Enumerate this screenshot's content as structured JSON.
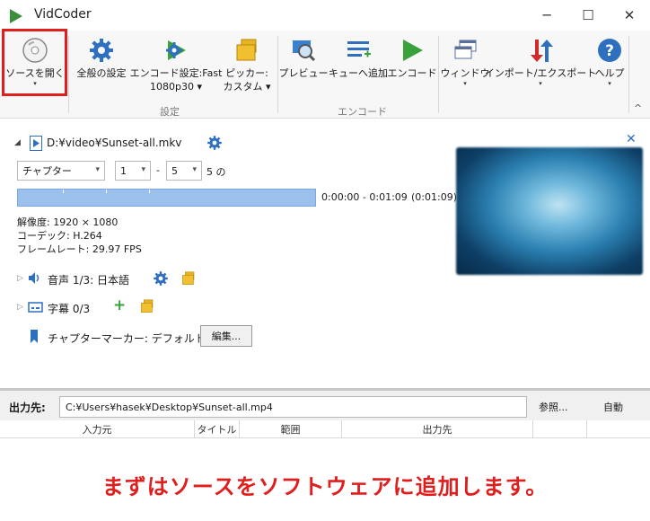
{
  "window": {
    "title": "VidCoder",
    "minimize": "─",
    "maximize": "☐",
    "close": "✕"
  },
  "ribbon": {
    "buttons": [
      {
        "label": "ソースを開く",
        "arrow": "▾"
      },
      {
        "label": "全般の設定"
      },
      {
        "label": "エンコード設定:Fast 1080p30",
        "label_line1": "エンコード設定:Fast",
        "label_line2": "1080p30 ▾"
      },
      {
        "label_line1": "ピッカー:",
        "label_line2": "カスタム ▾"
      },
      {
        "label": "プレビュー"
      },
      {
        "label": "キューへ追加"
      },
      {
        "label": "エンコード"
      },
      {
        "label": "ウィンドウ",
        "arrow": "▾"
      },
      {
        "label": "インポート/エクスポート",
        "arrow": "▾"
      },
      {
        "label": "ヘルプ",
        "arrow": "▾"
      }
    ],
    "groups": {
      "settings": "設定",
      "encode": "エンコード"
    },
    "collapse": "^"
  },
  "source": {
    "path": "D:¥video¥Sunset-all.mkv",
    "close": "✕",
    "range_type": "チャプター",
    "range_start": "1",
    "range_sep": "-",
    "range_end": "5",
    "range_total": "5 の",
    "time_range": "0:00:00 - 0:01:09",
    "duration": "(0:01:09)",
    "resolution": "解像度: 1920 × 1080",
    "codec": "コーデック: H.264",
    "framerate": "フレームレート: 29.97 FPS",
    "audio": "音声 1/3: 日本語",
    "subtitle": "字幕 0/3",
    "chapter_markers": "チャプターマーカー: デフォルト",
    "edit_button": "編集..."
  },
  "output": {
    "label": "出力先:",
    "path": "C:¥Users¥hasek¥Desktop¥Sunset-all.mp4",
    "browse": "参照...",
    "auto": "自動"
  },
  "queue": {
    "columns": [
      "入力元",
      "タイトル",
      "範囲",
      "出力先"
    ]
  },
  "caption": "まずはソースをソフトウェアに追加します。",
  "colors": {
    "accent": "#1e73c8",
    "highlight": "#e01e1e",
    "progress": "#9cc0ec",
    "play_green": "#3aa23a"
  }
}
